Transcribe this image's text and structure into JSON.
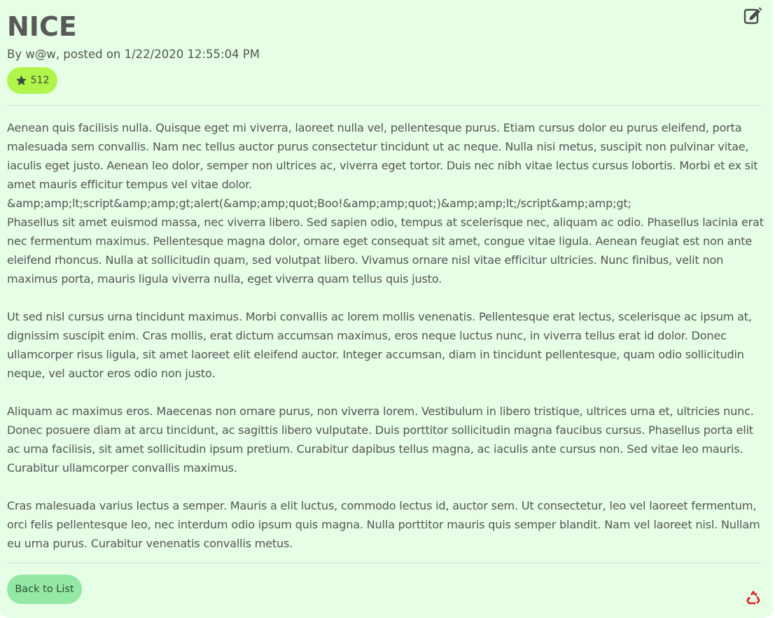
{
  "post": {
    "title": "NICE",
    "byline": "By w@w, posted on 1/22/2020 12:55:04 PM",
    "rating": "512",
    "body": [
      "Aenean quis facilisis nulla. Quisque eget mi viverra, laoreet nulla vel, pellentesque purus. Etiam cursus dolor eu purus eleifend, porta malesuada sem convallis. Nam nec tellus auctor purus consectetur tincidunt ut ac neque. Nulla nisi metus, suscipit non pulvinar vitae, iaculis eget justo. Aenean leo dolor, semper non ultrices ac, viverra eget tortor. Duis nec nibh vitae lectus cursus lobortis. Morbi et ex sit amet mauris efficitur tempus vel vitae dolor.\n&amp;amp;lt;script&amp;amp;gt;alert(&amp;amp;quot;Boo!&amp;amp;quot;)&amp;amp;lt;/script&amp;amp;gt;\nPhasellus sit amet euismod massa, nec viverra libero. Sed sapien odio, tempus at scelerisque nec, aliquam ac odio. Phasellus lacinia erat nec fermentum maximus. Pellentesque magna dolor, ornare eget consequat sit amet, congue vitae ligula. Aenean feugiat est non ante eleifend rhoncus. Nulla at sollicitudin quam, sed volutpat libero. Vivamus ornare nisl vitae efficitur ultricies. Nunc finibus, velit non maximus porta, mauris ligula viverra nulla, eget viverra quam tellus quis justo.",
      "Ut sed nisl cursus urna tincidunt maximus. Morbi convallis ac lorem mollis venenatis. Pellentesque erat lectus, scelerisque ac ipsum at, dignissim suscipit enim. Cras mollis, erat dictum accumsan maximus, eros neque luctus nunc, in viverra tellus erat id dolor. Donec ullamcorper risus ligula, sit amet laoreet elit eleifend auctor. Integer accumsan, diam in tincidunt pellentesque, quam odio sollicitudin neque, vel auctor eros odio non justo.",
      "Aliquam ac maximus eros. Maecenas non ornare purus, non viverra lorem. Vestibulum in libero tristique, ultrices urna et, ultricies nunc. Donec posuere diam at arcu tincidunt, ac sagittis libero vulputate. Duis porttitor sollicitudin magna faucibus cursus. Phasellus porta elit ac urna facilisis, sit amet sollicitudin ipsum pretium. Curabitur dapibus tellus magna, ac iaculis ante cursus non. Sed vitae leo mauris. Curabitur ullamcorper convallis maximus.",
      "Cras malesuada varius lectus a semper. Mauris a elit luctus, commodo lectus id, auctor sem. Ut consectetur, leo vel laoreet fermentum, orci felis pellentesque leo, nec interdum odio ipsum quis magna. Nulla porttitor mauris quis semper blandit. Nam vel laoreet nisl. Nullam eu urna purus. Curabitur venenatis convallis metus."
    ]
  },
  "actions": {
    "back_label": "Back to List"
  },
  "icons": {
    "edit": "edit-icon",
    "star": "star-icon",
    "recycle": "recycle-icon"
  },
  "colors": {
    "card_background": "#e6fee6",
    "rating_badge": "#b1f54a",
    "back_button": "#95e8a4",
    "recycle_icon": "#e02020",
    "text": "#555555"
  }
}
